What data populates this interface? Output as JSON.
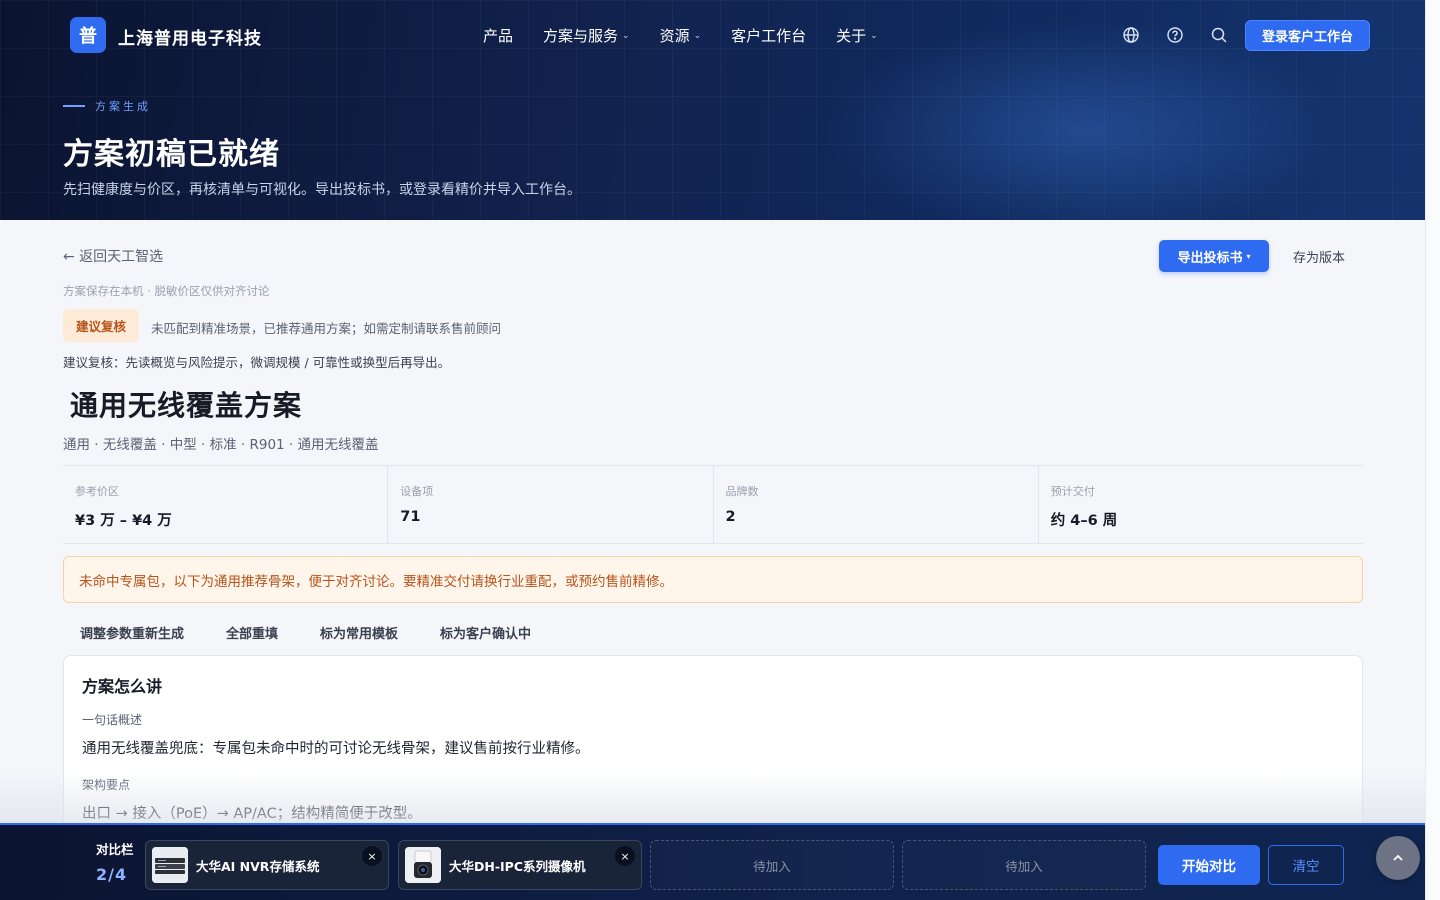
{
  "brand": {
    "mark": "普",
    "name": "上海普用电子科技"
  },
  "nav": {
    "items": [
      {
        "label": "产品",
        "has_menu": false
      },
      {
        "label": "方案与服务",
        "has_menu": true
      },
      {
        "label": "资源",
        "has_menu": true
      },
      {
        "label": "客户工作台",
        "has_menu": false
      },
      {
        "label": "关于",
        "has_menu": true
      }
    ],
    "chevron": "⌄",
    "icons": [
      "globe-icon",
      "help-icon",
      "search-icon"
    ],
    "login_label": "登录客户工作台"
  },
  "hero": {
    "eyebrow": "方案生成",
    "title": "方案初稿已就绪",
    "subtitle": "先扫健康度与价区，再核清单与可视化。导出投标书，或登录看精价并导入工作台。"
  },
  "toolbar": {
    "back_label": "← 返回天工智选",
    "export_label": "导出投标书",
    "export_chevron": "▾",
    "save_label": "存为版本"
  },
  "notice": {
    "local_note": "方案保存在本机 · 脱敏价区仅供对齐讨论",
    "review_tag": "建议复核",
    "review_message": "未匹配到精准场景，已推荐通用方案；如需定制请联系售前顾问",
    "review_hint": "建议复核：先读概览与风险提示，微调规模 / 可靠性或换型后再导出。"
  },
  "plan": {
    "title": "通用无线覆盖方案",
    "tags": "通用 · 无线覆盖 · 中型 · 标准 · R901 · 通用无线覆盖"
  },
  "stats": [
    {
      "label": "参考价区",
      "value": "¥3 万 – ¥4 万"
    },
    {
      "label": "设备项",
      "value": "71"
    },
    {
      "label": "品牌数",
      "value": "2"
    },
    {
      "label": "预计交付",
      "value": "约 4–6 周"
    }
  ],
  "warning": "未命中专属包，以下为通用推荐骨架，便于对齐讨论。要精准交付请换行业重配，或预约售前精修。",
  "actions": [
    "调整参数重新生成",
    "全部重填",
    "标为常用模板",
    "标为客户确认中"
  ],
  "pitch": {
    "title": "方案怎么讲",
    "sections": [
      {
        "label": "一句话概述",
        "text": "通用无线覆盖兜底：专属包未命中时的可讨论无线骨架，建议售前按行业精修。"
      },
      {
        "label": "架构要点",
        "text": "出口 → 接入（PoE）→ AP/AC；结构精简便于改型。"
      }
    ]
  },
  "compare": {
    "label": "对比栏",
    "count": "2/4",
    "slots": [
      {
        "name": "大华AI NVR存储系统",
        "thumb": "nvr-device-image"
      },
      {
        "name": "大华DH-IPC系列摄像机",
        "thumb": "camera-device-image"
      }
    ],
    "empty_label": "待加入",
    "start_label": "开始对比",
    "clear_label": "清空",
    "close_glyph": "×"
  },
  "colors": {
    "accent": "#2e6bf0",
    "hero_bg": "#0f2350",
    "warning_text": "#b8531a",
    "warning_bg": "#fff5ea"
  }
}
